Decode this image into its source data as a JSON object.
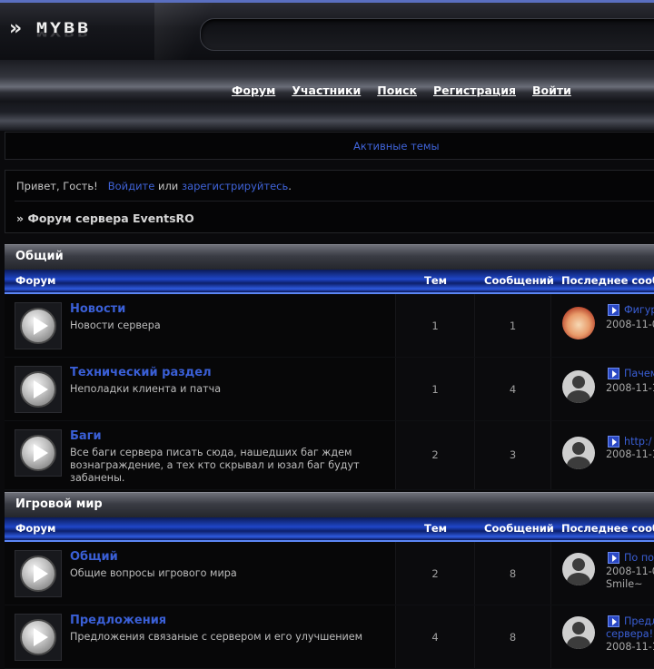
{
  "brand": {
    "logo_text": "MYBB",
    "logo_chevron": "»"
  },
  "nav": {
    "items": [
      {
        "label": "Форум"
      },
      {
        "label": "Участники"
      },
      {
        "label": "Поиск"
      },
      {
        "label": "Регистрация"
      },
      {
        "label": "Войти"
      }
    ]
  },
  "active_topics": {
    "label": "Активные темы"
  },
  "welcome": {
    "greeting": "Привет, Гость!",
    "login_link": "Войдите",
    "or_text": "или",
    "register_link": "зарегистрируйтесь",
    "period": "."
  },
  "breadcrumb": {
    "prefix": "»",
    "label": "Форум сервера EventsRO"
  },
  "columns": {
    "forum": "Форум",
    "threads": "Тем",
    "posts": "Сообщений",
    "last_post": "Последнее сооб"
  },
  "categories": [
    {
      "title": "Общий",
      "forums": [
        {
          "name": "Новости",
          "description": "Новости сервера",
          "threads": "1",
          "posts": "1",
          "last_post": {
            "avatar": "anime-avatar-icon",
            "title": "Фигур",
            "lines": [
              "2008-11-0"
            ]
          }
        },
        {
          "name": "Технический раздел",
          "description": "Неполадки клиента и патча",
          "threads": "1",
          "posts": "4",
          "last_post": {
            "avatar": "default-avatar-icon",
            "title": "Пачем",
            "lines": [
              "2008-11-1"
            ]
          }
        },
        {
          "name": "Баги",
          "description": "Все баги сервера писать сюда, нашедших баг ждем вознаграждение, а тех кто скрывал и юзал баг будут забанены.",
          "threads": "2",
          "posts": "3",
          "last_post": {
            "avatar": "default-avatar-icon",
            "title": "http:/",
            "lines": [
              "2008-11-1"
            ]
          }
        }
      ]
    },
    {
      "title": "Игровой мир",
      "forums": [
        {
          "name": "Общий",
          "description": "Общие вопросы игрового мира",
          "threads": "2",
          "posts": "8",
          "last_post": {
            "avatar": "default-avatar-icon",
            "title": "По пов",
            "lines": [
              "2008-11-0",
              "Smile~"
            ]
          }
        },
        {
          "name": "Предложения",
          "description": "Предложения связаные с сервером и его улучшением",
          "threads": "4",
          "posts": "8",
          "last_post": {
            "avatar": "default-avatar-icon",
            "title": "Предл",
            "lines": [
              "сервера!!",
              "2008-11-1"
            ]
          }
        }
      ]
    }
  ],
  "colors": {
    "link": "#3a5fd6",
    "accent_blue": "#1f46c8",
    "background": "#0a0a0c"
  }
}
